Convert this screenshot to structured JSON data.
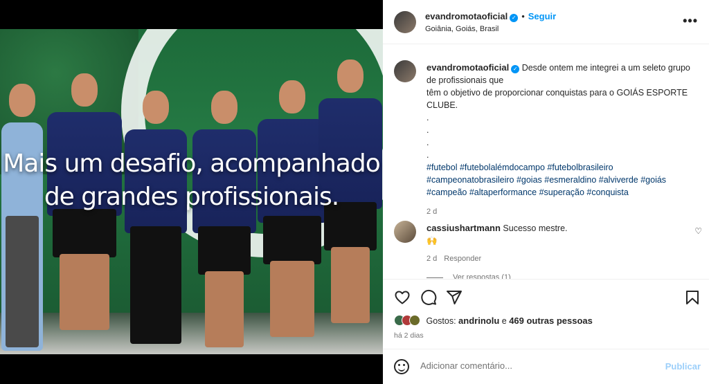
{
  "post": {
    "caption_overlay_line1": "Mais um desafio, acompanhado",
    "caption_overlay_line2": "de grandes profissionais."
  },
  "header": {
    "username": "evandromotaoficial",
    "verified_icon": "verified-badge-icon",
    "separator": "•",
    "follow_label": "Seguir",
    "location": "Goiânia, Goiás, Brasil",
    "more_icon": "more-options-icon",
    "more_label": "•••"
  },
  "caption": {
    "username": "evandromotaoficial",
    "text": "Desde ontem me integrei a um seleto grupo de profissionais que\ntêm o objetivo de proporcionar conquistas para o GOIÁS ESPORTE CLUBE.\n.\n.\n.\n.",
    "hashtags": "#futebol #futebolalémdocampo #futebolbrasileiro #campeonatobrasileiro #goias #esmeraldino #alviverde #goiás #campeão #altaperformance #superação #conquista",
    "time": "2 d"
  },
  "comments": [
    {
      "username": "cassiushartmann",
      "text": "Sucesso mestre.",
      "emoji": "🙌",
      "time": "2 d",
      "reply_label": "Responder"
    }
  ],
  "view_replies": "Ver respostas (1)",
  "actions": {
    "like_icon": "heart-icon",
    "comment_icon": "comment-icon",
    "share_icon": "share-icon",
    "save_icon": "bookmark-icon"
  },
  "likes": {
    "prefix": "Gostos:",
    "user": "andrinolu",
    "joiner": "e",
    "others": "469 outras pessoas"
  },
  "posted_ago": "há 2 dias",
  "add_comment": {
    "placeholder": "Adicionar comentário...",
    "publish_label": "Publicar"
  },
  "colors": {
    "accent": "#0095f6",
    "hashtag": "#00376b",
    "muted": "#737373",
    "publish_disabled": "#9ccffa"
  }
}
